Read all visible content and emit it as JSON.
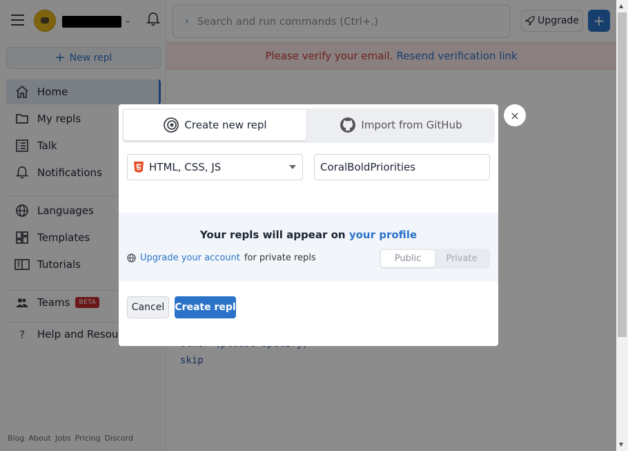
{
  "sidebar": {
    "new_repl_label": "New repl",
    "nav": [
      {
        "label": "Home",
        "icon": "home-icon"
      },
      {
        "label": "My repls",
        "icon": "folder-icon"
      },
      {
        "label": "Talk",
        "icon": "list-icon"
      },
      {
        "label": "Notifications",
        "icon": "bell-icon"
      },
      {
        "label": "Languages",
        "icon": "globe-icon"
      },
      {
        "label": "Templates",
        "icon": "grid-icon"
      },
      {
        "label": "Tutorials",
        "icon": "book-icon"
      },
      {
        "label": "Teams",
        "icon": "users-icon",
        "badge": "BETA"
      },
      {
        "label": "Help and Resour",
        "icon": "question-icon"
      }
    ],
    "footer_links": [
      "Blog",
      "About",
      "Jobs",
      "Pricing",
      "Discord"
    ]
  },
  "header": {
    "search_placeholder": "Search and run commands (Ctrl+.)",
    "upgrade_label": "Upgrade"
  },
  "banner": {
    "message": "Please verify your email.",
    "link": "Resend verification link"
  },
  "background": {
    "line1": "Other (please specify)",
    "line2": "skip"
  },
  "modal": {
    "tab_create": "Create new repl",
    "tab_import": "Import from GitHub",
    "language": "HTML, CSS, JS",
    "repl_name": "CoralBoldPriorities",
    "info_prefix": "Your repls will appear on",
    "info_link": "your profile",
    "upgrade_link": "Upgrade your account",
    "upgrade_suffix": "for private repls",
    "toggle_public": "Public",
    "toggle_private": "Private",
    "cancel_label": "Cancel",
    "create_label": "Create repl",
    "close_glyph": "×"
  },
  "colors": {
    "accent": "#2b73c9",
    "danger": "#c43d3d",
    "beta": "#c32d2d"
  }
}
